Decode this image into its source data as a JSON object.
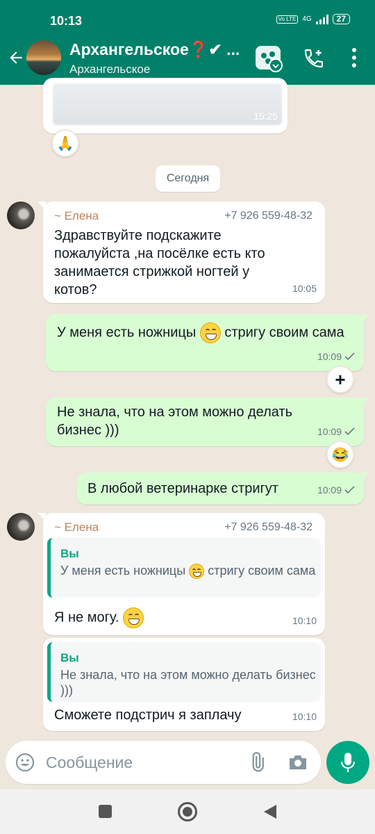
{
  "status_bar": {
    "time": "10:13",
    "network": "4G",
    "volte": "Vo LTE",
    "battery": "27"
  },
  "header": {
    "title": "Архангельское❓✔ ...",
    "subtitle": "Архангельское"
  },
  "date_divider": "Сегодня",
  "previous_message": {
    "time": "15:25",
    "reaction": "🙏"
  },
  "messages": [
    {
      "sender": "~ Елена",
      "phone": "+7 926 559-48-32",
      "text": "Здравствуйте  подскажите пожалуйста ,на посёлке есть кто занимается стрижкой ногтей у котов?",
      "time": "10:05"
    },
    {
      "text_before": "У меня есть ножницы",
      "text_after": "стригу своим сама",
      "time": "10:09",
      "reaction": "+"
    },
    {
      "text": "Не знала, что на этом можно делать бизнес )))",
      "time": "10:09",
      "reaction": "😂"
    },
    {
      "text": "В любой ветеринарке стригут",
      "time": "10:09"
    },
    {
      "sender": "~ Елена",
      "phone": "+7 926 559-48-32",
      "quote_author": "Вы",
      "quote_text_before": "У меня есть ножницы",
      "quote_text_after": "стригу своим сама",
      "text": "Я не могу.",
      "time": "10:10"
    },
    {
      "quote_author": "Вы",
      "quote_text": "Не знала, что на этом можно делать бизнес )))",
      "text": "Сможете подстрич я заплачу",
      "time": "10:10"
    }
  ],
  "composer": {
    "placeholder": "Сообщение"
  },
  "colors": {
    "header": "#008069",
    "accent": "#00a884",
    "outgoing": "#d9fdd3",
    "chat_bg": "#efe7de"
  }
}
